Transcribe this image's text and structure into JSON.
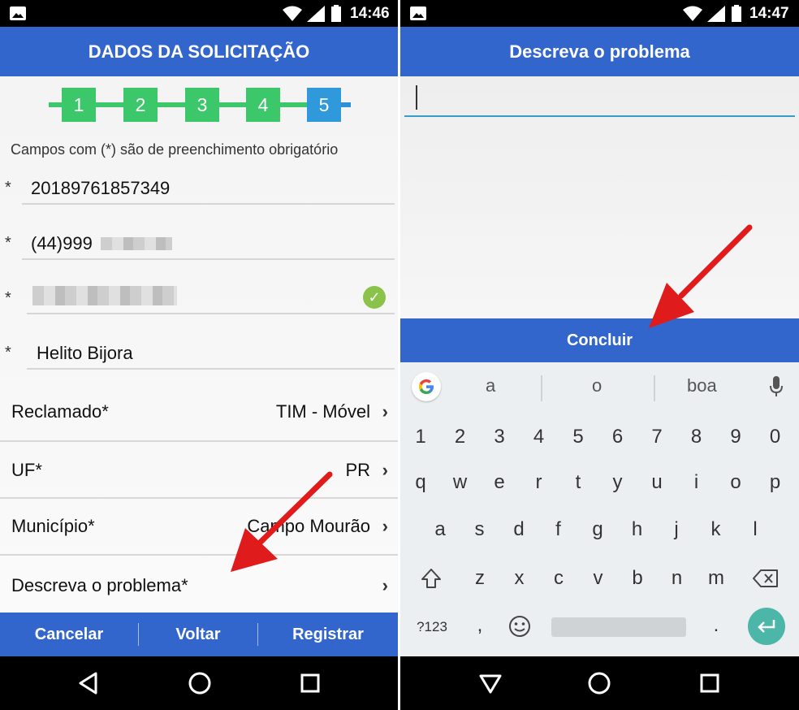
{
  "left": {
    "status": {
      "time": "14:46"
    },
    "title": "DADOS DA SOLICITAÇÃO",
    "steps": [
      "1",
      "2",
      "3",
      "4",
      "5"
    ],
    "required_note": "Campos com (*) são de preenchimento obrigatório",
    "fields": [
      {
        "star": "*",
        "value": "20189761857349"
      },
      {
        "star": "*",
        "value": "(44)999"
      },
      {
        "star": "*",
        "value": ""
      },
      {
        "star": "*",
        "value": "Helito Bijora"
      }
    ],
    "rows": [
      {
        "label": "Reclamado*",
        "value": "TIM - Móvel"
      },
      {
        "label": "UF*",
        "value": "PR"
      },
      {
        "label": "Município*",
        "value": "Campo Mourão"
      },
      {
        "label": "Descreva o problema*",
        "value": ""
      }
    ],
    "buttons": {
      "cancel": "Cancelar",
      "back": "Voltar",
      "register": "Registrar"
    }
  },
  "right": {
    "status": {
      "time": "14:47"
    },
    "title": "Descreva o problema",
    "input_value": "",
    "conclude": "Concluir",
    "keyboard": {
      "suggestions": [
        "a",
        "o",
        "boa"
      ],
      "row_numbers": [
        "1",
        "2",
        "3",
        "4",
        "5",
        "6",
        "7",
        "8",
        "9",
        "0"
      ],
      "row1": [
        "q",
        "w",
        "e",
        "r",
        "t",
        "y",
        "u",
        "i",
        "o",
        "p"
      ],
      "row2": [
        "a",
        "s",
        "d",
        "f",
        "g",
        "h",
        "j",
        "k",
        "l"
      ],
      "row3": [
        "z",
        "x",
        "c",
        "v",
        "b",
        "n",
        "m"
      ],
      "symbols_key": "?123",
      "comma_key": ",",
      "period_key": "."
    }
  },
  "colors": {
    "brand_blue": "#3366cc",
    "step_green": "#3cc76a",
    "step_blue": "#2f99dc",
    "enter_teal": "#4cb6a8"
  }
}
